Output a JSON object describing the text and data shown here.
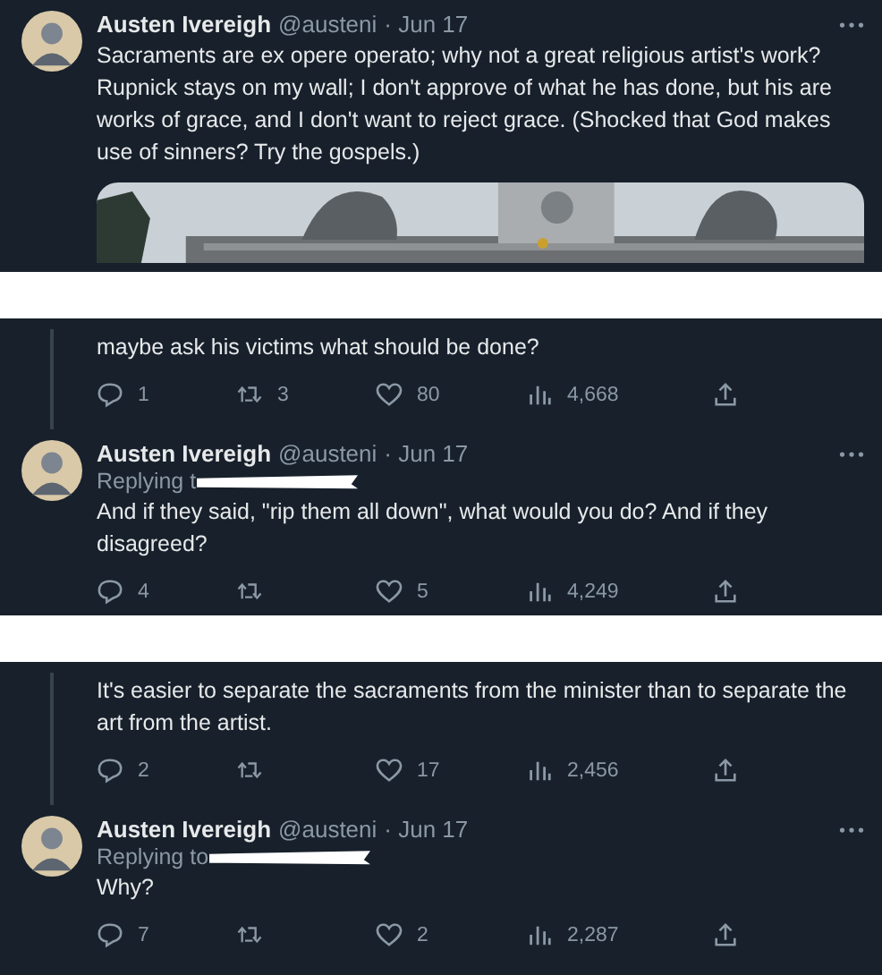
{
  "panels": [
    {
      "tweets": [
        {
          "kind": "full",
          "name": "Austen Ivereigh",
          "handle": "@austeni",
          "date": "· Jun 17",
          "text": "Sacraments are ex opere operato; why not a great religious artist's work? Rupnick stays on my wall; I don't approve of what he has done, but his are works of grace, and I don't want to reject grace. (Shocked that God makes use of sinners? Try the gospels.)"
        }
      ]
    },
    {
      "tweets": [
        {
          "kind": "fragment",
          "text": "maybe ask his victims what should be done?",
          "actions": [
            {
              "kind": "reply",
              "count": "1"
            },
            {
              "kind": "retweet",
              "count": "3"
            },
            {
              "kind": "like",
              "count": "80"
            },
            {
              "kind": "views",
              "count": "4,668"
            },
            {
              "kind": "share"
            }
          ]
        },
        {
          "kind": "full",
          "name": "Austen Ivereigh",
          "handle": "@austeni",
          "date": "· Jun 17",
          "replying": "Replying t",
          "redacted": true,
          "text": "And if they said, \"rip them all down\", what would you do? And if they disagreed?",
          "actions": [
            {
              "kind": "reply",
              "count": "4"
            },
            {
              "kind": "retweet"
            },
            {
              "kind": "like",
              "count": "5"
            },
            {
              "kind": "views",
              "count": "4,249"
            },
            {
              "kind": "share"
            }
          ]
        }
      ]
    },
    {
      "tweets": [
        {
          "kind": "fragment",
          "text": "It's easier to separate the sacraments from the minister than to separate the art from the artist.",
          "actions": [
            {
              "kind": "reply",
              "count": "2"
            },
            {
              "kind": "retweet"
            },
            {
              "kind": "like",
              "count": "17"
            },
            {
              "kind": "views",
              "count": "2,456"
            },
            {
              "kind": "share"
            }
          ]
        },
        {
          "kind": "full",
          "name": "Austen Ivereigh",
          "handle": "@austeni",
          "date": "· Jun 17",
          "replying": "Replying to",
          "redacted": true,
          "text": "Why?",
          "actions": [
            {
              "kind": "reply",
              "count": "7"
            },
            {
              "kind": "retweet"
            },
            {
              "kind": "like",
              "count": "2"
            },
            {
              "kind": "views",
              "count": "2,287"
            },
            {
              "kind": "share"
            }
          ]
        }
      ]
    }
  ]
}
